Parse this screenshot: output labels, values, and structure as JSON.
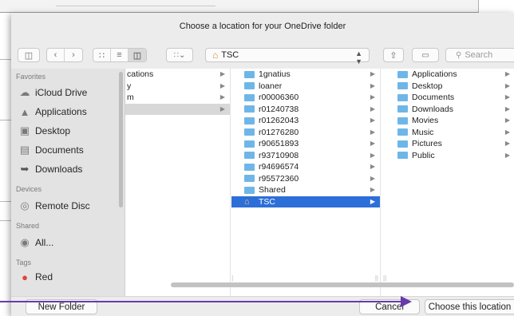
{
  "dialog": {
    "title": "Choose a location for your OneDrive folder"
  },
  "toolbar": {
    "path_label": "TSC",
    "search_placeholder": "Search"
  },
  "sidebar": {
    "favorites_header": "Favorites",
    "favorites": [
      {
        "label": "iCloud Drive",
        "icon": "cloud-icon"
      },
      {
        "label": "Applications",
        "icon": "applications-icon"
      },
      {
        "label": "Desktop",
        "icon": "desktop-icon"
      },
      {
        "label": "Documents",
        "icon": "documents-icon"
      },
      {
        "label": "Downloads",
        "icon": "downloads-icon"
      }
    ],
    "devices_header": "Devices",
    "devices": [
      {
        "label": "Remote Disc",
        "icon": "disc-icon"
      }
    ],
    "shared_header": "Shared",
    "shared": [
      {
        "label": "All...",
        "icon": "network-icon"
      }
    ],
    "tags_header": "Tags",
    "tags": [
      {
        "label": "Red",
        "color": "#e0443b"
      }
    ]
  },
  "columns": {
    "col1": [
      "cations",
      "y",
      "m",
      ""
    ],
    "col2": [
      "1gnatius",
      "loaner",
      "r00006360",
      "r01240738",
      "r01262043",
      "r01276280",
      "r90651893",
      "r93710908",
      "r94696574",
      "r95572360",
      "Shared",
      "TSC"
    ],
    "col2_selected": "TSC",
    "col3": [
      "Applications",
      "Desktop",
      "Documents",
      "Downloads",
      "Movies",
      "Music",
      "Pictures",
      "Public"
    ]
  },
  "footer": {
    "new_folder_label": "New Folder",
    "cancel_label": "Cancel",
    "choose_label": "Choose this location"
  },
  "colors": {
    "selection": "#2d6fd8",
    "folder": "#6fb6e8",
    "annotation_arrow": "#6a3aa8"
  }
}
